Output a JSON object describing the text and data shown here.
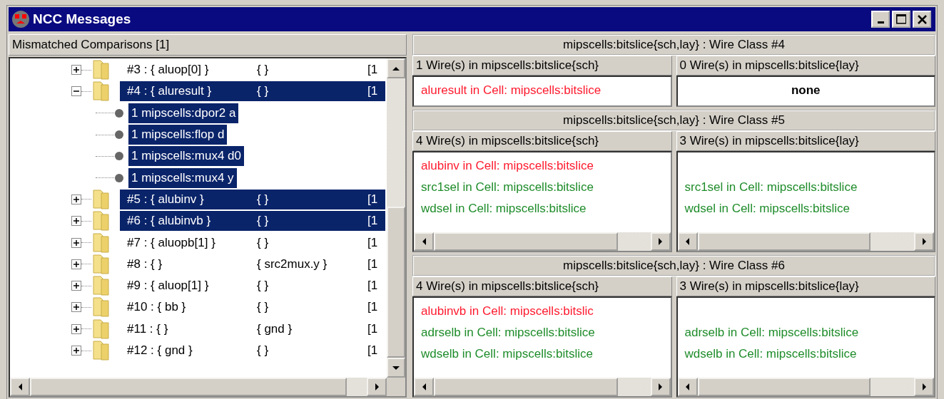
{
  "window": {
    "title": "NCC Messages"
  },
  "tree_pane": {
    "header": "Mismatched Comparisons [1]",
    "rows": [
      {
        "expanded": false,
        "selected": false,
        "column_1": "#3 : { aluop[0] }",
        "column_2": "{ }",
        "column_3": "[1",
        "children": []
      },
      {
        "expanded": true,
        "selected": true,
        "column_1": "#4 : { aluresult }",
        "column_2": "{ }",
        "column_3": "[1",
        "children": [
          {
            "label": "1 mipscells:dpor2 a",
            "selected": true
          },
          {
            "label": "1 mipscells:flop d",
            "selected": true
          },
          {
            "label": "1 mipscells:mux4 d0",
            "selected": true
          },
          {
            "label": "1 mipscells:mux4 y",
            "selected": true
          }
        ]
      },
      {
        "expanded": false,
        "selected": true,
        "column_1": "#5 : { alubinv }",
        "column_2": "{ }",
        "column_3": "[1",
        "children": []
      },
      {
        "expanded": false,
        "selected": true,
        "column_1": "#6 : { alubinvb }",
        "column_2": "{ }",
        "column_3": "[1",
        "children": []
      },
      {
        "expanded": false,
        "selected": false,
        "column_1": "#7 : { aluopb[1] }",
        "column_2": "{ }",
        "column_3": "[1",
        "children": []
      },
      {
        "expanded": false,
        "selected": false,
        "column_1": "#8 : { }",
        "column_2": "{ src2mux.y }",
        "column_3": "[1",
        "children": []
      },
      {
        "expanded": false,
        "selected": false,
        "column_1": "#9 : { aluop[1] }",
        "column_2": "{ }",
        "column_3": "[1",
        "children": []
      },
      {
        "expanded": false,
        "selected": false,
        "column_1": "#10 : { bb }",
        "column_2": "{ }",
        "column_3": "[1",
        "children": []
      },
      {
        "expanded": false,
        "selected": false,
        "column_1": "#11 : { }",
        "column_2": "{ gnd }",
        "column_3": "[1",
        "children": []
      },
      {
        "expanded": false,
        "selected": false,
        "column_1": "#12 : { gnd }",
        "column_2": "{ }",
        "column_3": "[1",
        "children": []
      }
    ]
  },
  "wire_classes": [
    {
      "title": "mipscells:bitslice{sch,lay} : Wire Class #4",
      "scrollbars": false,
      "columns": [
        {
          "header": "1 Wire(s) in mipscells:bitslice{sch}",
          "entries": [
            {
              "kind": "wire",
              "text": "aluresult in Cell: mipscells:bitslice",
              "color": "#ff1a2e"
            }
          ]
        },
        {
          "header": "0 Wire(s) in mipscells:bitslice{lay}",
          "entries": [
            {
              "kind": "none",
              "text": "none"
            }
          ]
        }
      ]
    },
    {
      "title": "mipscells:bitslice{sch,lay} : Wire Class #5",
      "scrollbars": true,
      "columns": [
        {
          "header": "4 Wire(s) in mipscells:bitslice{sch}",
          "entries": [
            {
              "kind": "wire",
              "text": "alubinv in Cell: mipscells:bitslice",
              "color": "#ff1a2e"
            },
            {
              "kind": "wire",
              "text": "src1sel in Cell: mipscells:bitslice",
              "color": "#1e8c2a"
            },
            {
              "kind": "wire",
              "text": "wdsel in Cell: mipscells:bitslice",
              "color": "#1e8c2a"
            }
          ]
        },
        {
          "header": "3 Wire(s) in mipscells:bitslice{lay}",
          "entries": [
            {
              "kind": "gap"
            },
            {
              "kind": "wire",
              "text": "src1sel in Cell: mipscells:bitslice",
              "color": "#1e8c2a"
            },
            {
              "kind": "wire",
              "text": "wdsel in Cell: mipscells:bitslice",
              "color": "#1e8c2a"
            }
          ]
        }
      ]
    },
    {
      "title": "mipscells:bitslice{sch,lay} : Wire Class #6",
      "scrollbars": true,
      "columns": [
        {
          "header": "4 Wire(s) in mipscells:bitslice{sch}",
          "entries": [
            {
              "kind": "wire",
              "text": "alubinvb in Cell: mipscells:bitslic",
              "color": "#ff1a2e"
            },
            {
              "kind": "wire",
              "text": "adrselb in Cell: mipscells:bitslice",
              "color": "#1e8c2a"
            },
            {
              "kind": "wire",
              "text": "wdselb in Cell: mipscells:bitslice",
              "color": "#1e8c2a"
            }
          ]
        },
        {
          "header": "3 Wire(s) in mipscells:bitslice{lay}",
          "entries": [
            {
              "kind": "gap"
            },
            {
              "kind": "wire",
              "text": "adrselb in Cell: mipscells:bitslice",
              "color": "#1e8c2a"
            },
            {
              "kind": "wire",
              "text": "wdselb in Cell: mipscells:bitslice",
              "color": "#1e8c2a"
            }
          ]
        }
      ]
    }
  ]
}
